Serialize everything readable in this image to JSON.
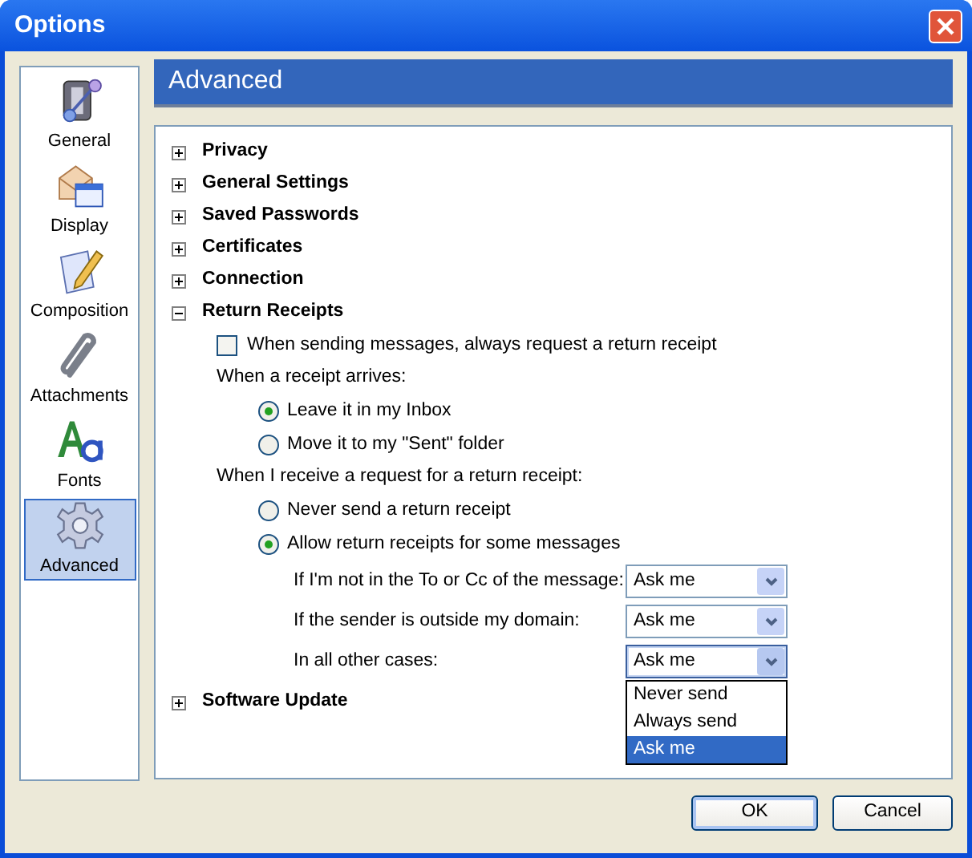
{
  "window": {
    "title": "Options"
  },
  "sidebar": {
    "items": [
      {
        "label": "General",
        "selected": false
      },
      {
        "label": "Display",
        "selected": false
      },
      {
        "label": "Composition",
        "selected": false
      },
      {
        "label": "Attachments",
        "selected": false
      },
      {
        "label": "Fonts",
        "selected": false
      },
      {
        "label": "Advanced",
        "selected": true
      }
    ]
  },
  "panel": {
    "title": "Advanced"
  },
  "sections": [
    {
      "label": "Privacy",
      "expanded": false
    },
    {
      "label": "General Settings",
      "expanded": false
    },
    {
      "label": "Saved Passwords",
      "expanded": false
    },
    {
      "label": "Certificates",
      "expanded": false
    },
    {
      "label": "Connection",
      "expanded": false
    },
    {
      "label": "Return Receipts",
      "expanded": true,
      "items": [
        {
          "kind": "checkbox",
          "label": "When sending messages, always request a return receipt",
          "checked": false
        },
        {
          "kind": "label",
          "label": "When a receipt arrives:"
        },
        {
          "kind": "radio",
          "label": "Leave it in my Inbox",
          "selected": true
        },
        {
          "kind": "radio",
          "label": "Move it to my \"Sent\" folder",
          "selected": false
        },
        {
          "kind": "label",
          "label": "When I receive a request for a return receipt:"
        },
        {
          "kind": "radio",
          "label": "Never send a return receipt",
          "selected": false
        },
        {
          "kind": "radio",
          "label": "Allow return receipts for some messages",
          "selected": true
        },
        {
          "kind": "select",
          "label": "If I'm not in the To or Cc of the message:",
          "value": "Ask me",
          "open": false
        },
        {
          "kind": "select",
          "label": "If the sender is outside my domain:",
          "value": "Ask me",
          "open": false
        },
        {
          "kind": "select",
          "label": "In all other cases:",
          "value": "Ask me",
          "open": true,
          "options": [
            {
              "label": "Never send",
              "selected": false
            },
            {
              "label": "Always send",
              "selected": false
            },
            {
              "label": "Ask me",
              "selected": true
            }
          ]
        }
      ]
    },
    {
      "label": "Software Update",
      "expanded": false
    }
  ],
  "buttons": [
    {
      "label": "OK",
      "default": true
    },
    {
      "label": "Cancel",
      "default": false
    }
  ]
}
